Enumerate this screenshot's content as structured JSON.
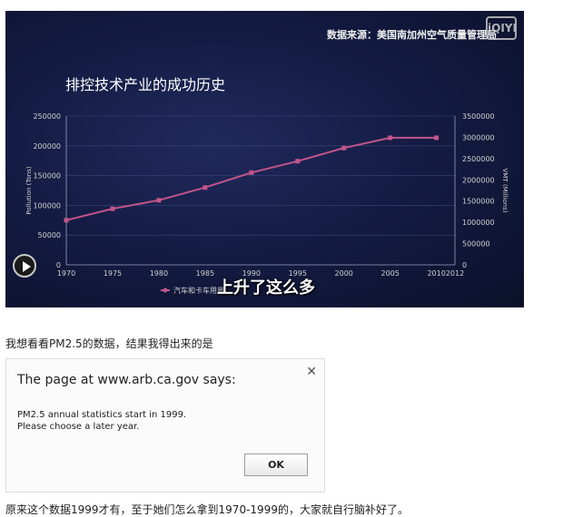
{
  "video": {
    "source_text": "数据来源：美国南加州空气质量管理局",
    "logo_text": "iQIYI",
    "subtitle": "上升了这么多",
    "play_icon": "play-icon"
  },
  "chart_data": {
    "type": "line",
    "title": "排控技术产业的成功历史",
    "ylabel": "Pollution (Tons)",
    "y2label": "VMT (Millions)",
    "x": [
      1970,
      1975,
      1980,
      1985,
      1990,
      1995,
      2000,
      2005,
      2010
    ],
    "xticks": [
      "1970",
      "1975",
      "1980",
      "1985",
      "1990",
      "1995",
      "2000",
      "2005",
      "2010",
      "2012"
    ],
    "xlim": [
      1970,
      2012
    ],
    "ylim": [
      0,
      250000
    ],
    "yticks": [
      "0",
      "50000",
      "100000",
      "150000",
      "200000",
      "250000"
    ],
    "y2lim": [
      0,
      3500000
    ],
    "y2ticks": [
      "0",
      "500000",
      "1000000",
      "1500000",
      "2000000",
      "2500000",
      "3000000",
      "3500000"
    ],
    "series": [
      {
        "name": "汽车和卡车用量",
        "axis": "right",
        "color": "#c2558a",
        "values": [
          1050000,
          1320000,
          1520000,
          1820000,
          2170000,
          2440000,
          2750000,
          2990000,
          2990000
        ]
      }
    ],
    "legend_position": "bottom",
    "grid": true
  },
  "text_above_dialog": "我想看看PM2.5的数据，结果我得出来的是",
  "dialog": {
    "title": "The page at www.arb.ca.gov says:",
    "message": "PM2.5 annual statistics start in 1999.\nPlease choose a later year.",
    "ok_label": "OK",
    "close_icon": "close-icon"
  },
  "text_below_dialog": "原来这个数据1999才有，至于她们怎么拿到1970-1999的，大家就自行脑补好了。"
}
